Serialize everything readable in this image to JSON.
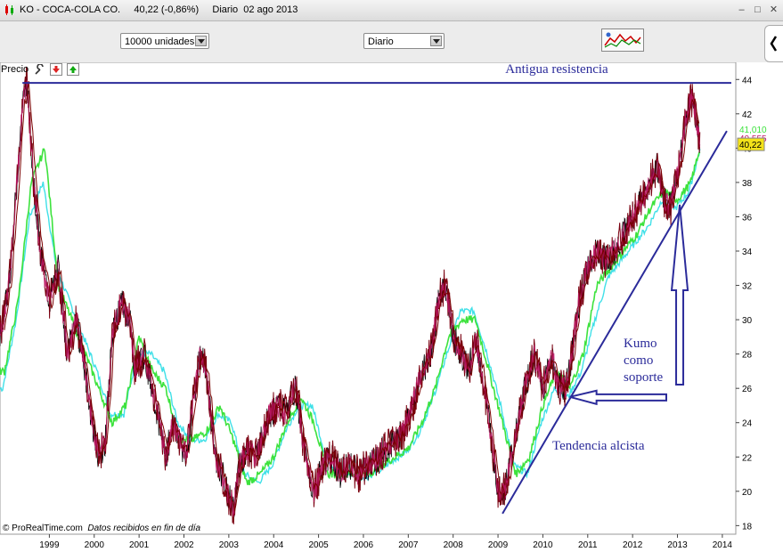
{
  "window": {
    "title": "KO - COCA-COLA CO.     40,22 (-0,86%)     Diario  02 ago 2013",
    "minimize": "–",
    "restore": "□",
    "close": "✕"
  },
  "toolbar": {
    "units_select": "10000 unidades",
    "period_select": "Diario",
    "indicator_icon": "chart-indicators-icon"
  },
  "panel": {
    "label": "Precio",
    "wrench_icon": "wrench-icon",
    "down_icon": "red-down-arrow-icon",
    "up_icon": "green-up-arrow-icon"
  },
  "footer": {
    "brand": "© ProRealTime.com",
    "note": "Datos recibidos en fin de día"
  },
  "colors": {
    "price": "#7a0010",
    "price_dark": "#000000",
    "price_mid": "#c0186a",
    "kumo_green": "#3de23d",
    "kumo_cyan": "#40e0e8",
    "tenkan": "#7a0000",
    "annotation": "#2b2b9a",
    "price_label_bg": "#f3e21a"
  },
  "chart_data": {
    "type": "line",
    "x_ticks": [
      "1999",
      "2000",
      "2001",
      "2002",
      "2003",
      "2004",
      "2005",
      "2006",
      "2007",
      "2008",
      "2009",
      "2010",
      "2011",
      "2012",
      "2013",
      "2014"
    ],
    "y_ticks": [
      "18",
      "20",
      "22",
      "24",
      "26",
      "28",
      "30",
      "32",
      "34",
      "36",
      "38",
      "40",
      "42",
      "44"
    ],
    "ylim": [
      17.5,
      45
    ],
    "xlim": [
      1998.0,
      2014.4
    ],
    "price_axis_labels": [
      "41,010",
      "40,555",
      "40,22"
    ],
    "series": [
      {
        "x": [
          1998.0,
          1998.2,
          1998.35,
          1998.5,
          1998.6,
          1998.75,
          1998.9,
          1999.1,
          1999.3,
          1999.5,
          1999.7,
          1999.9,
          2000.05,
          2000.2,
          2000.35,
          2000.5,
          2000.7,
          2000.9,
          2001.0,
          2001.2,
          2001.4,
          2001.55,
          2001.7,
          2001.85,
          2002.0,
          2002.15,
          2002.3,
          2002.45,
          2002.6,
          2002.8,
          2002.95,
          2003.05,
          2003.2,
          2003.35,
          2003.5,
          2003.7,
          2003.9,
          2004.0,
          2004.2,
          2004.4,
          2004.5,
          2004.6,
          2004.75,
          2004.9,
          2005.0,
          2005.2,
          2005.4,
          2005.6,
          2005.8,
          2006.0,
          2006.2,
          2006.4,
          2006.6,
          2006.8,
          2007.0,
          2007.2,
          2007.4,
          2007.6,
          2007.8,
          2007.95,
          2008.1,
          2008.3,
          2008.45,
          2008.6,
          2008.8,
          2008.95,
          2009.1,
          2009.25,
          2009.4,
          2009.55,
          2009.7,
          2009.9,
          2010.1,
          2010.3,
          2010.45,
          2010.6,
          2010.75,
          2010.9,
          2011.1,
          2011.3,
          2011.5,
          2011.7,
          2011.9,
          2012.1,
          2012.3,
          2012.5,
          2012.65,
          2012.8,
          2012.95,
          2013.1,
          2013.2,
          2013.3,
          2013.45,
          2013.55,
          2013.6
        ],
        "values": [
          29,
          32,
          37,
          42.5,
          44,
          38,
          34,
          31,
          33,
          28,
          30,
          27,
          24,
          22,
          23,
          29,
          31,
          30,
          27,
          28,
          26,
          24,
          22,
          24,
          23,
          22,
          25,
          28,
          27,
          22,
          21,
          20,
          19,
          21.5,
          22.5,
          22,
          23.5,
          24.5,
          25,
          24.5,
          25.5,
          26,
          23,
          21,
          20,
          21.5,
          22,
          21,
          21.5,
          21,
          21.5,
          22,
          22.5,
          23,
          23.5,
          25,
          27,
          28,
          31.5,
          32,
          29,
          28,
          27,
          29,
          26,
          23,
          20,
          20,
          22,
          24,
          26,
          28,
          26,
          28,
          26,
          26,
          28,
          31,
          33,
          34,
          33.5,
          34,
          35,
          36,
          37,
          38,
          39,
          37,
          36.5,
          38.5,
          40,
          42,
          43,
          41,
          40.22
        ]
      },
      {
        "x": [
          1998.0,
          1998.3,
          1998.6,
          1998.9,
          1999.2,
          1999.5,
          1999.8,
          2000.1,
          2000.4,
          2000.7,
          2001.0,
          2001.3,
          2001.6,
          2001.9,
          2002.2,
          2002.5,
          2002.8,
          2003.1,
          2003.4,
          2003.7,
          2004.0,
          2004.3,
          2004.6,
          2004.9,
          2005.2,
          2005.5,
          2005.8,
          2006.1,
          2006.4,
          2006.7,
          2007.0,
          2007.3,
          2007.6,
          2007.9,
          2008.2,
          2008.5,
          2008.8,
          2009.1,
          2009.4,
          2009.7,
          2010.0,
          2010.3,
          2010.6,
          2010.9,
          2011.2,
          2011.5,
          2011.8,
          2012.1,
          2012.4,
          2012.7,
          2013.0,
          2013.3,
          2013.6
        ],
        "values": [
          27,
          31,
          38,
          40,
          32,
          30,
          28,
          26,
          24,
          25,
          29,
          27,
          26,
          23,
          23,
          23.5,
          25,
          23,
          20.5,
          21,
          22,
          24,
          25.5,
          24,
          21,
          21,
          21,
          21,
          21.5,
          22,
          22.5,
          24,
          26,
          29,
          30,
          30,
          27,
          24,
          21,
          22,
          25,
          27,
          26,
          28,
          32,
          33,
          34,
          35,
          36.5,
          37.5,
          37,
          38,
          41
        ]
      },
      {
        "x": [
          1998.0,
          1998.3,
          1998.6,
          1998.9,
          1999.2,
          1999.5,
          1999.8,
          2000.1,
          2000.4,
          2000.7,
          2001.0,
          2001.3,
          2001.6,
          2001.9,
          2002.2,
          2002.5,
          2002.8,
          2003.1,
          2003.4,
          2003.7,
          2004.0,
          2004.3,
          2004.6,
          2004.9,
          2005.2,
          2005.5,
          2005.8,
          2006.1,
          2006.4,
          2006.7,
          2007.0,
          2007.3,
          2007.6,
          2007.9,
          2008.2,
          2008.5,
          2008.8,
          2009.1,
          2009.4,
          2009.7,
          2010.0,
          2010.3,
          2010.6,
          2010.9,
          2011.2,
          2011.5,
          2011.8,
          2012.1,
          2012.4,
          2012.7,
          2013.0,
          2013.3,
          2013.6
        ],
        "values": [
          26,
          30,
          36,
          38,
          33,
          31,
          29,
          27,
          24.5,
          24.5,
          28,
          28,
          27,
          24,
          23,
          23,
          24.5,
          24,
          21,
          20.5,
          21.5,
          23.5,
          25,
          25,
          22,
          21,
          21,
          20.8,
          21.2,
          21.8,
          22.3,
          23.5,
          25.5,
          28,
          30.5,
          30.5,
          28,
          25,
          21.5,
          21,
          24,
          26,
          25.5,
          27,
          30,
          32.5,
          33.5,
          34.5,
          35.5,
          37,
          36.5,
          37.5,
          40.5
        ]
      }
    ],
    "annotations": [
      {
        "text": "Antigua resistencia",
        "type": "horizontal_line",
        "y": 43.8,
        "x_from": 1998.5,
        "x_to": 2014.3
      },
      {
        "text": "Tendencia alcista",
        "type": "trend_line",
        "from": [
          2009.2,
          18.7
        ],
        "to": [
          2014.2,
          41.0
        ]
      },
      {
        "text": "Kumo como soporte",
        "type": "arrows",
        "points": [
          [
            2010.7,
            25.5
          ],
          [
            2013.15,
            36.7
          ]
        ]
      }
    ]
  }
}
